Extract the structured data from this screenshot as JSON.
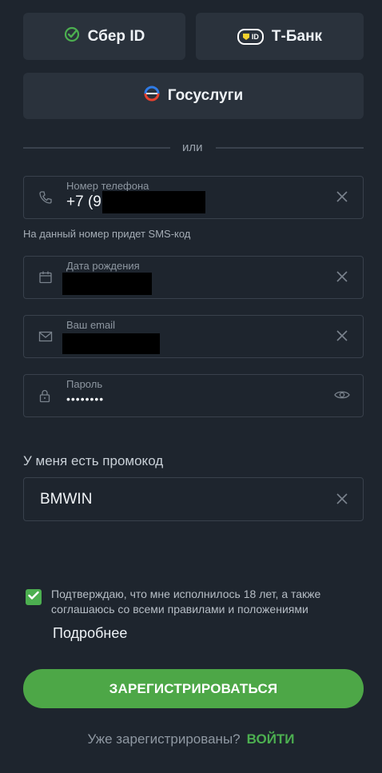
{
  "providers": {
    "sber_label": "Сбер ID",
    "tbank_label": "Т-Банк",
    "tbank_badge": "ID",
    "gosuslugi_label": "Госуслуги"
  },
  "divider": {
    "text": "или"
  },
  "phone": {
    "label": "Номер телефона",
    "value": "+7 (9",
    "hint": "На данный номер придет SMS-код"
  },
  "birthdate": {
    "label": "Дата рождения"
  },
  "email": {
    "label": "Ваш email"
  },
  "password": {
    "label": "Пароль",
    "value": "••••••••"
  },
  "promo": {
    "section_label": "У меня есть промокод",
    "value": "BMWIN"
  },
  "consent": {
    "checked": true,
    "line1": "Подтверждаю, что мне исполнилось 18 лет, а также",
    "line2": "соглашаюсь со всеми правилами и положениями",
    "more_label": "Подробнее"
  },
  "register": {
    "label": "ЗАРЕГИСТРИРОВАТЬСЯ"
  },
  "login": {
    "prompt": "Уже зарегистрированы?",
    "link": "ВОЙТИ"
  },
  "colors": {
    "background": "#1e252e",
    "card": "#2a323c",
    "accent_green": "#4caf50",
    "field_border": "#39414c"
  }
}
